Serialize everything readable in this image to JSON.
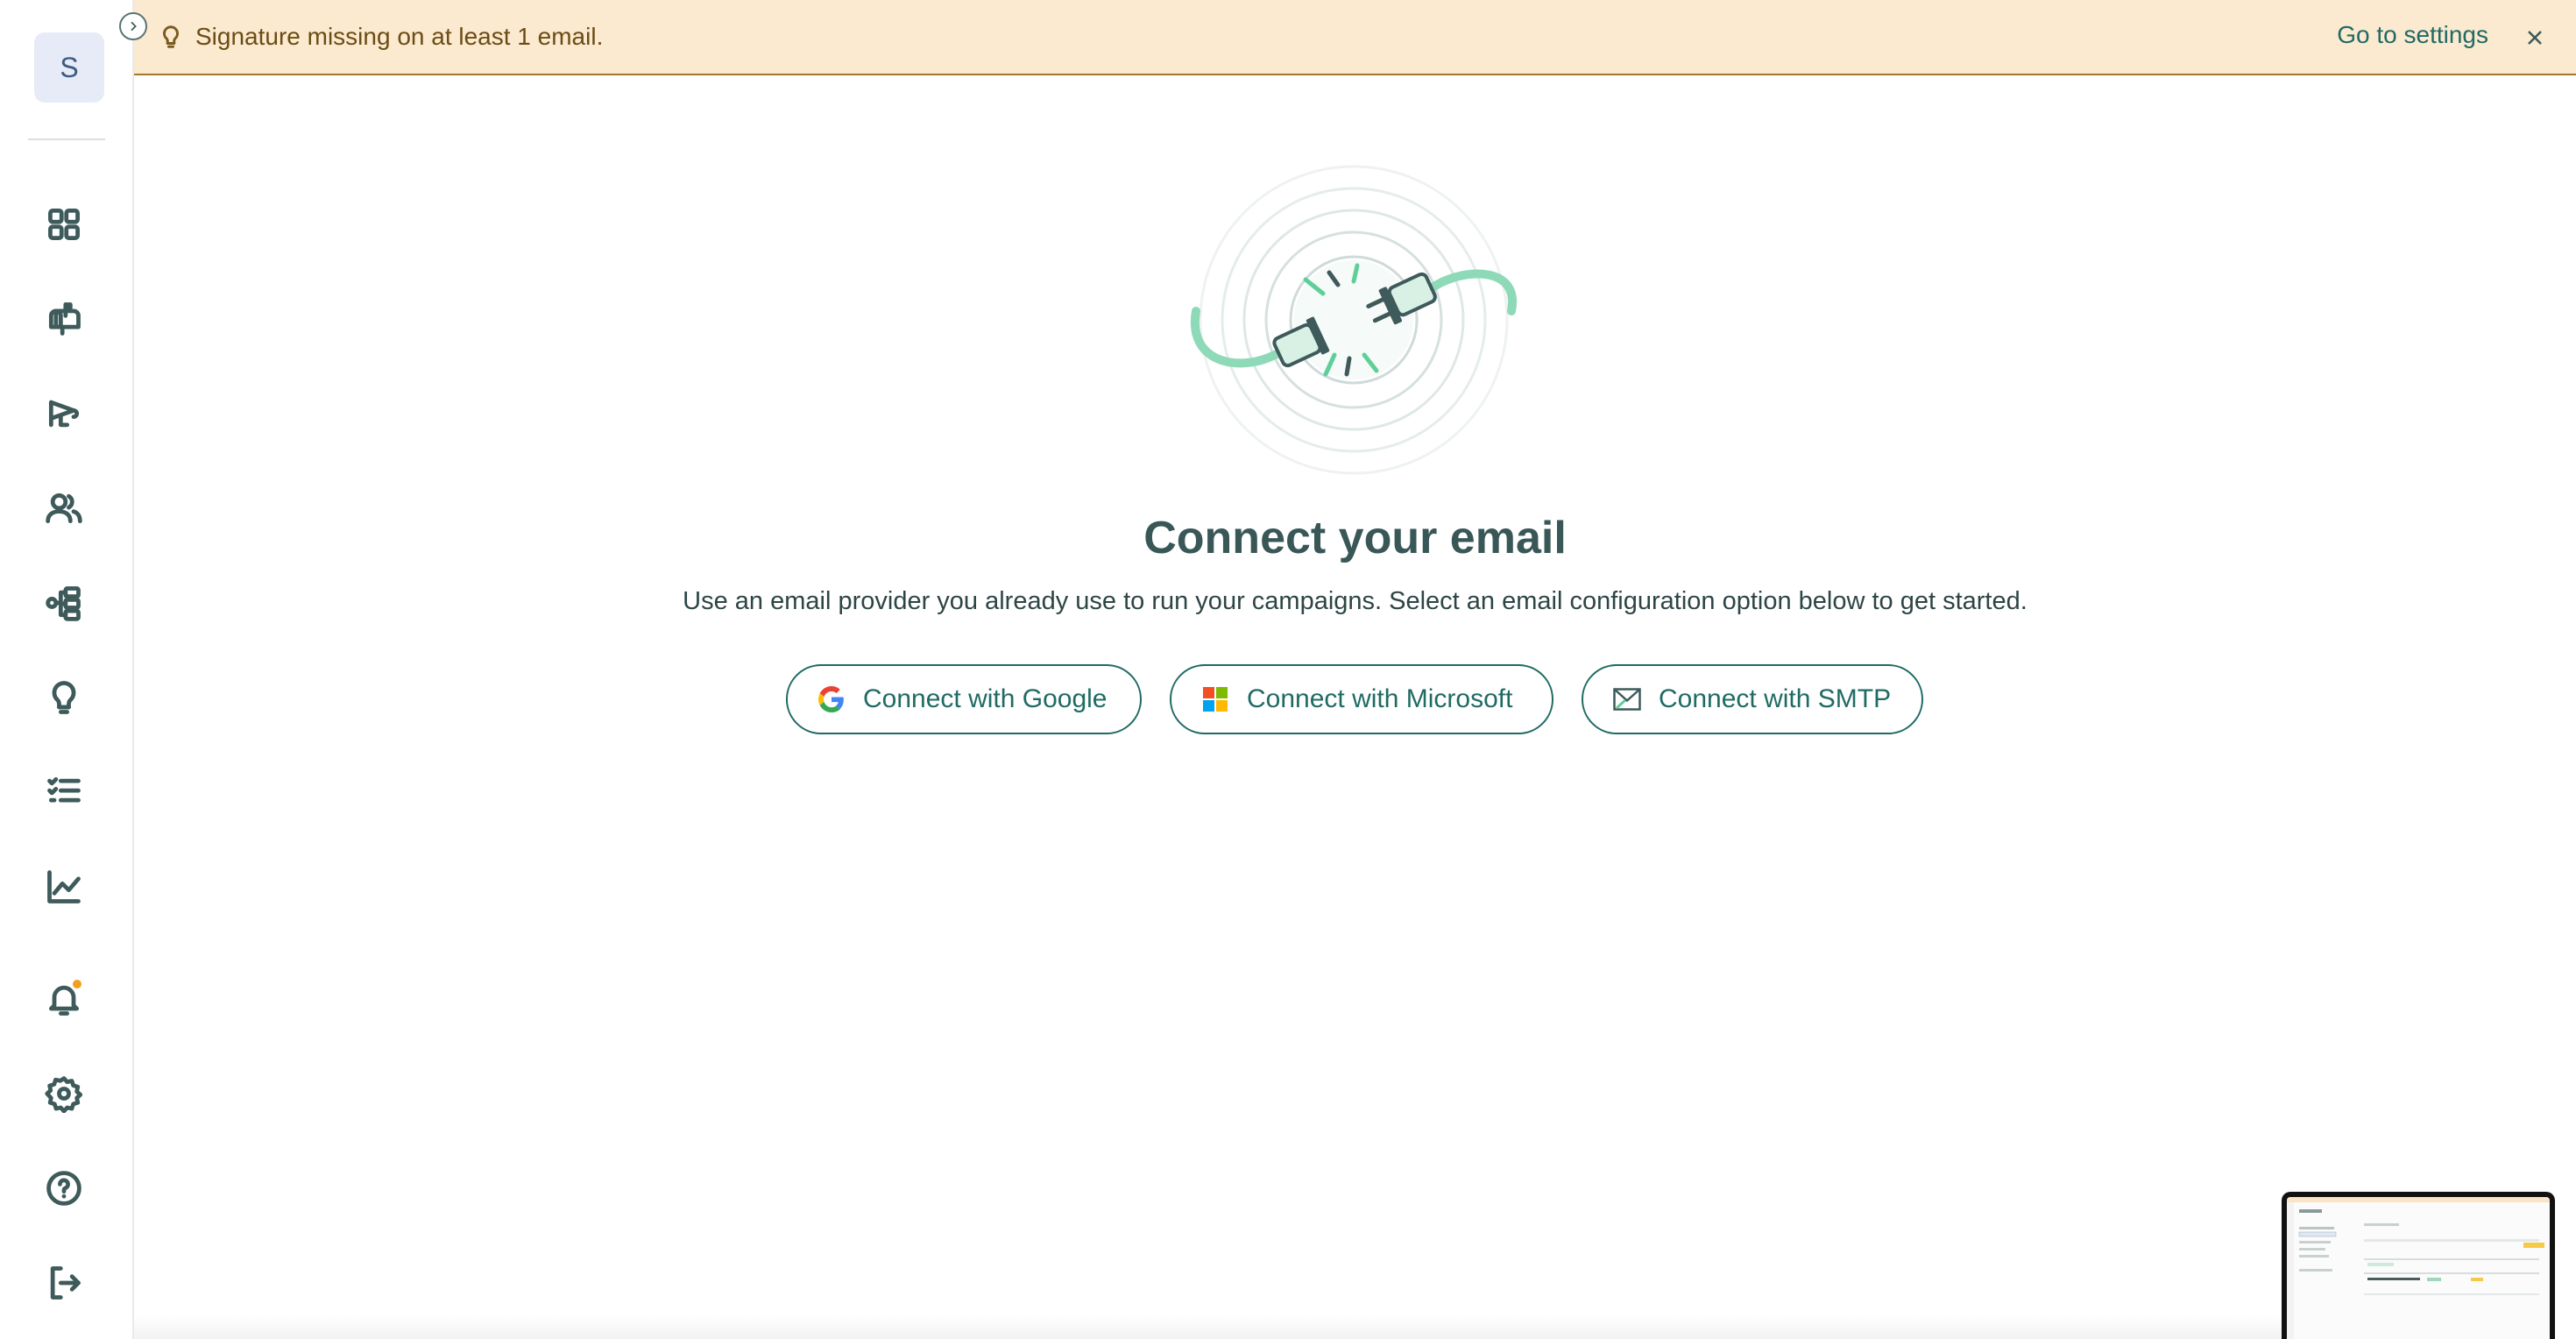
{
  "sidebar": {
    "avatar_initial": "S",
    "items": [
      {
        "name": "dashboard",
        "icon": "grid-icon"
      },
      {
        "name": "mailbox",
        "icon": "mailbox-icon"
      },
      {
        "name": "campaigns",
        "icon": "megaphone-icon"
      },
      {
        "name": "contacts",
        "icon": "users-icon"
      },
      {
        "name": "workflows",
        "icon": "hierarchy-icon"
      },
      {
        "name": "insights",
        "icon": "lightbulb-icon"
      },
      {
        "name": "tasks",
        "icon": "checklist-icon"
      },
      {
        "name": "analytics",
        "icon": "line-chart-icon"
      },
      {
        "name": "notifications",
        "icon": "bell-icon"
      },
      {
        "name": "settings",
        "icon": "gear-icon"
      },
      {
        "name": "help",
        "icon": "help-circle-icon"
      },
      {
        "name": "logout",
        "icon": "logout-icon"
      }
    ]
  },
  "banner": {
    "message": "Signature missing on at least 1 email.",
    "link_label": "Go to settings",
    "background": "#fbe9d0"
  },
  "main": {
    "title": "Connect your email",
    "subtitle": "Use an email provider you already use to run your campaigns. Select an email configuration option below to get started.",
    "buttons": {
      "google": "Connect with Google",
      "microsoft": "Connect with Microsoft",
      "smtp": "Connect with SMTP"
    }
  },
  "colors": {
    "accent": "#1f6b64",
    "notification_dot": "#f0a020",
    "illustration_green": "#5fcf9a"
  }
}
